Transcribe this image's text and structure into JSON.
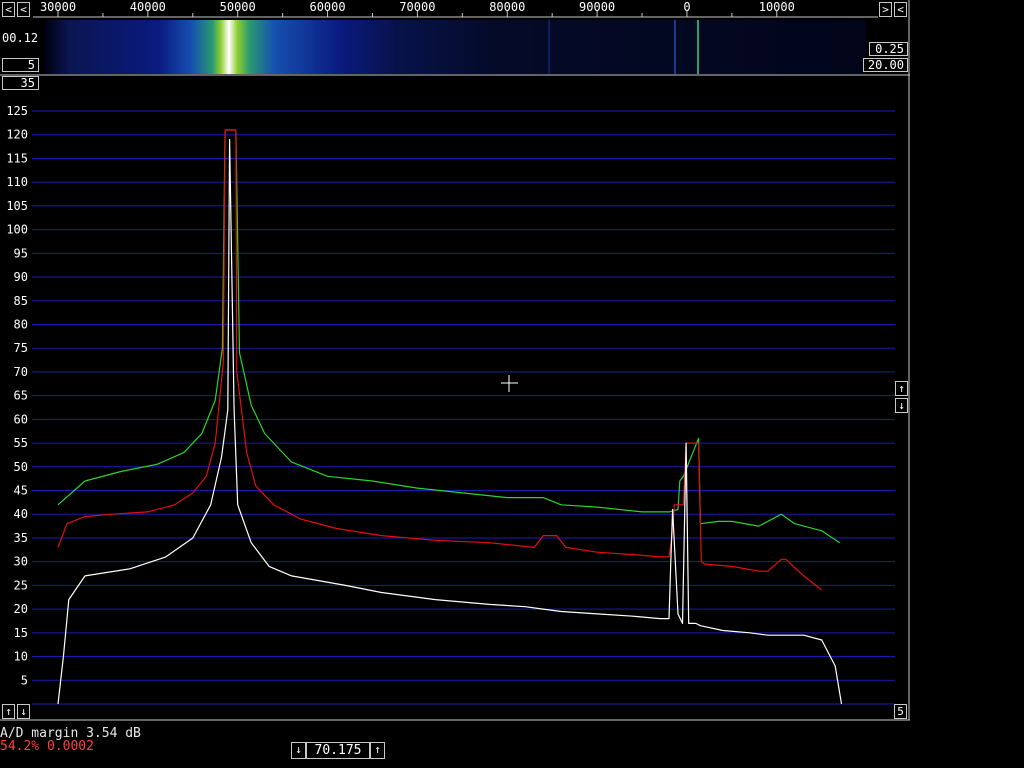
{
  "freq_scale": {
    "labels": [
      "30000",
      "40000",
      "50000",
      "60000",
      "70000",
      "80000",
      "90000",
      "0",
      "10000"
    ]
  },
  "left_params": {
    "top": "00.12",
    "mid": "5",
    "below": "35"
  },
  "right_params": {
    "top": "0.25",
    "bottom": "20.00"
  },
  "nav": {
    "scale_left": "<",
    "scale_right": ">",
    "amp_up": "↑",
    "amp_down": "↓",
    "bottom_left_up": "↑",
    "bottom_left_down": "↓",
    "bottom_right_value": "5"
  },
  "status": {
    "ad_margin": "A/D margin 3.54 dB",
    "cpu_load": "54.2% 0.0002"
  },
  "tuning": {
    "down": "↓",
    "value": "70.175",
    "up": "↑"
  },
  "colors": {
    "grid": "#1b1bb4",
    "peak_trace": "#2bd42b",
    "average_trace": "#e01010",
    "spectrum_trace": "#ffffff",
    "status_warning": "#ff4040"
  },
  "chart_data": {
    "type": "line",
    "yticks": [
      5,
      10,
      15,
      20,
      25,
      30,
      35,
      40,
      45,
      50,
      55,
      60,
      65,
      70,
      75,
      80,
      85,
      90,
      95,
      100,
      105,
      110,
      115,
      120,
      125
    ],
    "ylim": [
      0,
      127
    ],
    "x_ticks_freq": [
      30000,
      40000,
      50000,
      60000,
      70000,
      80000,
      90000,
      0,
      10000
    ],
    "grid": true,
    "series": [
      {
        "color": "#2bd42b",
        "x": [
          30000,
          33000,
          37000,
          41000,
          44000,
          46000,
          47500,
          48300,
          48600,
          49800,
          50200,
          51500,
          53000,
          56000,
          60000,
          65000,
          70000,
          75000,
          80000,
          84000,
          86000,
          90000,
          95000,
          98000,
          99000,
          99200,
          99600,
          101300,
          101500,
          103500,
          105000,
          108000,
          110500,
          112000,
          115000,
          117000
        ],
        "y": [
          42,
          47,
          49,
          50.5,
          53,
          57,
          64,
          75,
          121,
          121,
          74,
          63,
          57,
          51,
          48,
          47,
          45.5,
          44.5,
          43.5,
          43.5,
          42,
          41.5,
          40.5,
          40.5,
          41,
          47,
          48,
          56,
          38,
          38.5,
          38.5,
          37.5,
          40,
          38,
          36.5,
          34
        ]
      },
      {
        "color": "#e01010",
        "x": [
          30000,
          31000,
          33000,
          36000,
          40000,
          43000,
          45000,
          46500,
          47500,
          48400,
          48600,
          49800,
          49900,
          51000,
          52000,
          54000,
          57000,
          61000,
          66000,
          72000,
          78000,
          83000,
          84000,
          85500,
          86500,
          90000,
          94000,
          97000,
          98000,
          98300,
          98600,
          99600,
          99900,
          101300,
          101600,
          102000,
          105000,
          108000,
          109000,
          110500,
          111000,
          113000,
          115000
        ],
        "y": [
          33,
          38,
          39.5,
          40,
          40.5,
          42,
          44.5,
          48,
          55,
          72,
          121,
          121,
          70,
          53,
          46,
          42,
          39,
          37,
          35.5,
          34.5,
          34,
          33,
          35.5,
          35.5,
          33,
          32,
          31.5,
          31,
          31,
          35,
          42,
          42,
          55,
          55,
          30,
          29.5,
          29,
          28,
          28,
          30.5,
          30.5,
          27,
          24
        ]
      },
      {
        "color": "#ffffff",
        "x": [
          30000,
          30600,
          31200,
          33000,
          38000,
          42000,
          45000,
          47000,
          48200,
          48900,
          49100,
          49600,
          49800,
          50000,
          51500,
          53500,
          56000,
          62000,
          66000,
          72000,
          78000,
          82000,
          84000,
          86000,
          90000,
          94000,
          97000,
          98000,
          98200,
          98400,
          99000,
          99500,
          99900,
          100200,
          101000,
          101500,
          104000,
          107000,
          109000,
          113000,
          115000,
          116500,
          117200
        ],
        "y": [
          0,
          10,
          22,
          27,
          28.5,
          31,
          35,
          42,
          52,
          62,
          119,
          62,
          52,
          42,
          34,
          29,
          27,
          25,
          23.5,
          22,
          21,
          20.5,
          20,
          19.5,
          19,
          18.5,
          18,
          18,
          30,
          41,
          19,
          17,
          55,
          17,
          17,
          16.5,
          15.5,
          15,
          14.5,
          14.5,
          13.5,
          8,
          0
        ]
      }
    ]
  }
}
